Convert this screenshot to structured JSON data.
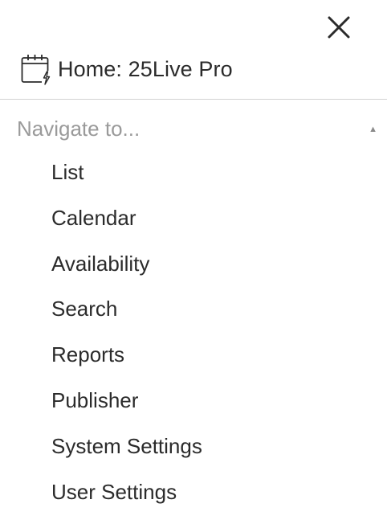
{
  "close": {
    "icon": "close-icon"
  },
  "home": {
    "icon": "calendar-lightning-icon",
    "label": "Home: 25Live Pro"
  },
  "navigate": {
    "title": "Navigate to...",
    "caret_icon": "caret-up-icon",
    "caret_glyph": "▲",
    "items": [
      {
        "label": "List"
      },
      {
        "label": "Calendar"
      },
      {
        "label": "Availability"
      },
      {
        "label": "Search"
      },
      {
        "label": "Reports"
      },
      {
        "label": "Publisher"
      },
      {
        "label": "System Settings"
      },
      {
        "label": "User Settings"
      }
    ]
  }
}
